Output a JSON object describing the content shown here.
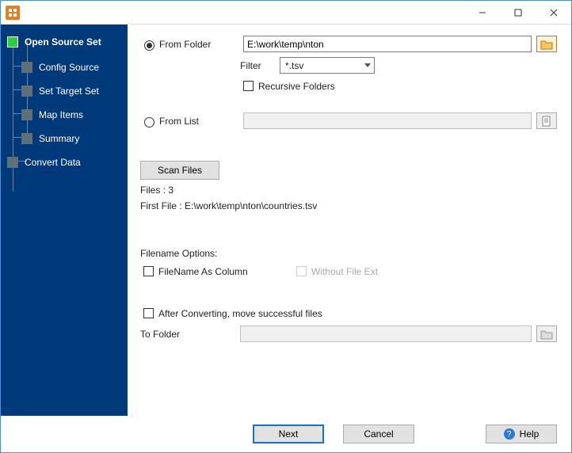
{
  "titlebar": {
    "minimize": "—",
    "maximize": "☐",
    "close": "✕"
  },
  "sidebar": {
    "items": [
      {
        "label": "Open Source Set"
      },
      {
        "label": "Config Source"
      },
      {
        "label": "Set Target Set"
      },
      {
        "label": "Map Items"
      },
      {
        "label": "Summary"
      },
      {
        "label": "Convert Data"
      }
    ]
  },
  "main": {
    "from_folder_label": "From Folder",
    "from_folder_value": "E:\\work\\temp\\nton",
    "filter_label": "Filter",
    "filter_value": "*.tsv",
    "recursive_label": "Recursive Folders",
    "from_list_label": "From List",
    "from_list_value": "",
    "scan_btn": "Scan Files",
    "files_count_label": "Files : 3",
    "first_file_label": "First File : E:\\work\\temp\\nton\\countries.tsv",
    "filename_options_label": "Filename Options:",
    "filename_as_col_label": "FileName As Column",
    "without_ext_label": "Without File Ext",
    "after_convert_label": "After Converting, move successful files",
    "to_folder_label": "To Folder",
    "to_folder_value": ""
  },
  "footer": {
    "next": "Next",
    "cancel": "Cancel",
    "help": "Help"
  }
}
